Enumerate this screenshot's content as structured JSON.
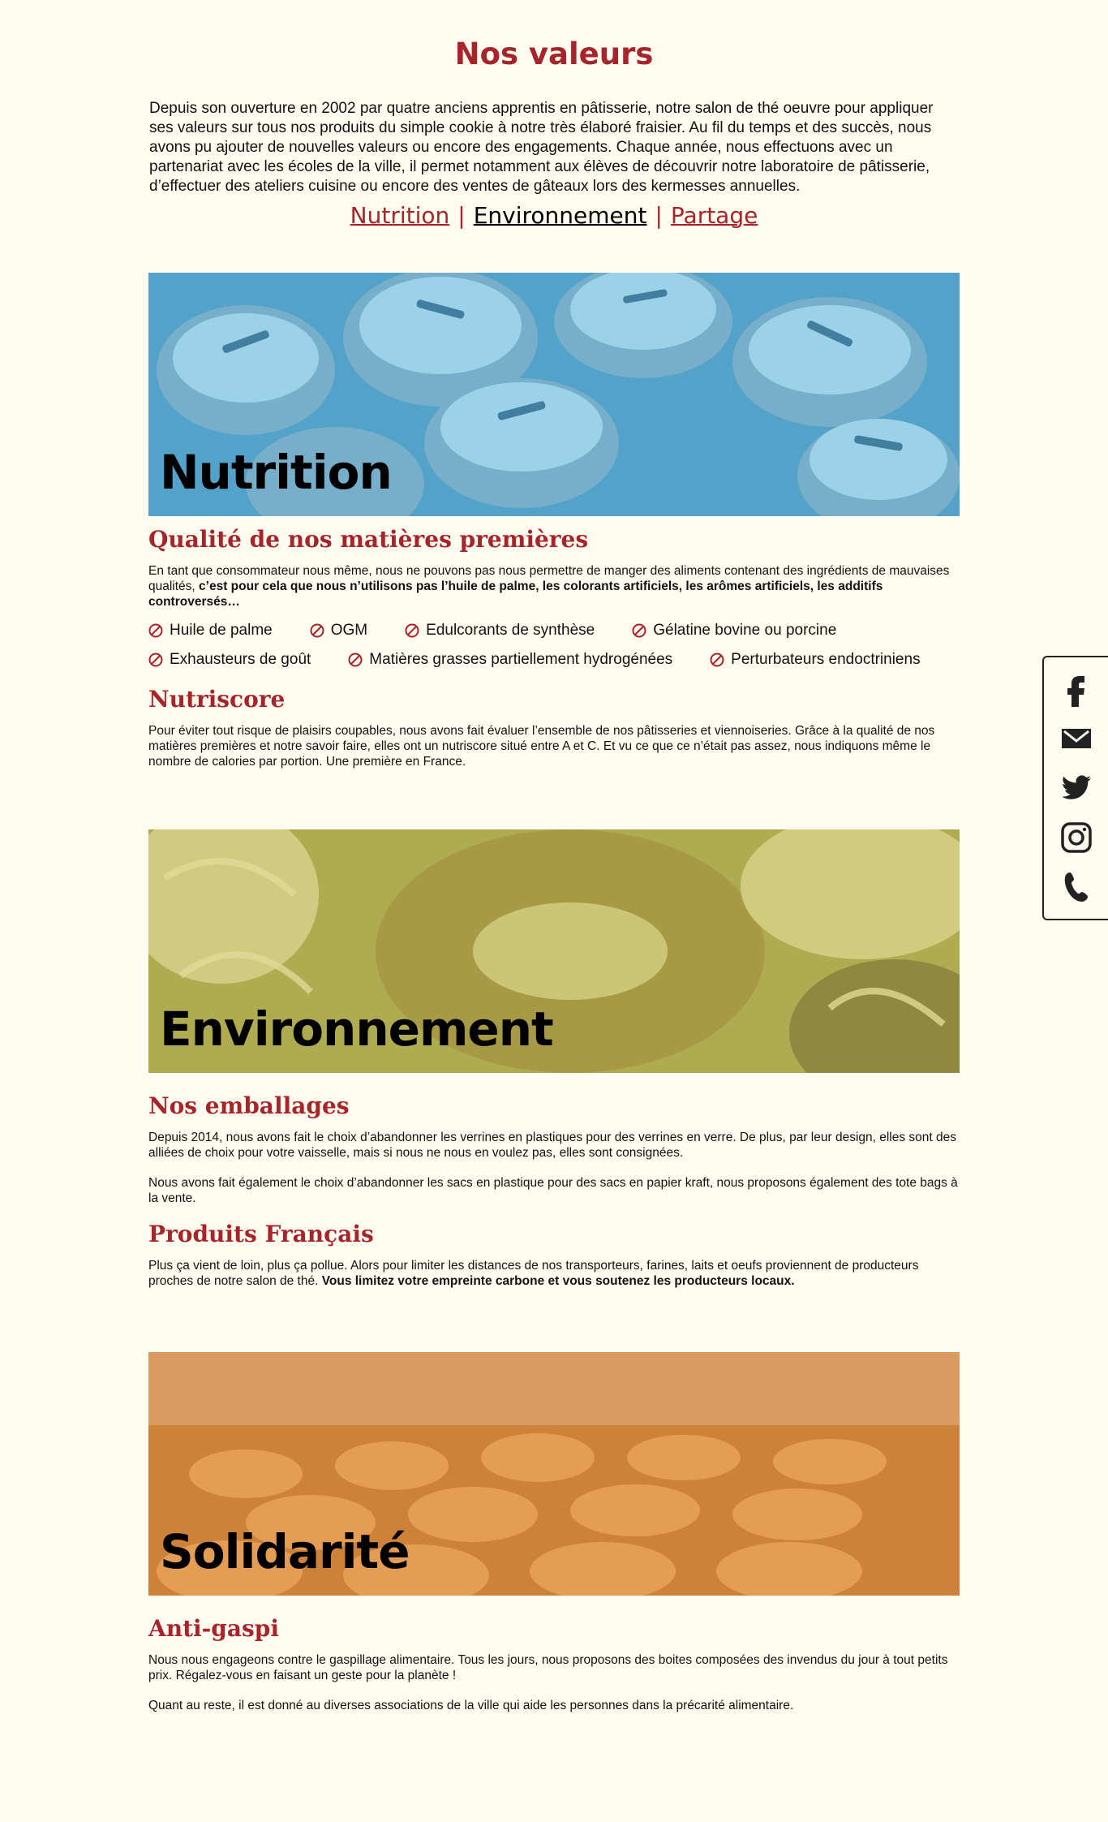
{
  "page": {
    "title": "Nos valeurs",
    "intro": "Depuis son ouverture en 2002 par quatre anciens apprentis en pâtisserie, notre salon de thé oeuvre pour appliquer ses valeurs sur tous nos produits du simple cookie à notre très élaboré fraisier. Au fil du temps et des succès, nous avons pu ajouter de nouvelles valeurs ou encore des engagements. Chaque année, nous effectuons avec un partenariat avec les écoles de la ville, il permet notamment aux élèves de découvrir notre laboratoire de pâtisserie, d’effectuer des ateliers cuisine ou encore des ventes de gâteaux lors des kermesses annuelles."
  },
  "nav": {
    "items": [
      "Nutrition",
      "Environnement",
      "Partage"
    ],
    "separator": "|"
  },
  "nutrition": {
    "banner_title": "Nutrition",
    "quality_title": "Qualité de nos matières premières",
    "quality_text": "En tant que consommateur nous même, nous ne pouvons pas nous permettre de manger des aliments contenant des ingrédients de mauvaises qualités, ",
    "quality_bold": "c’est pour cela que nous n’utilisons pas l’huile de palme, les colorants artificiels, les arômes artificiels, les additifs controversés…",
    "banned": [
      "Huile de palme",
      "OGM",
      "Edulcorants de synthèse",
      "Gélatine bovine ou porcine",
      "Exhausteurs de goût",
      "Matières grasses partiellement hydrogénées",
      "Perturbateurs endoctriniens"
    ],
    "nutriscore_title": "Nutriscore",
    "nutriscore_text": "Pour éviter tout risque de plaisirs coupables, nous avons fait évaluer l’ensemble de nos pâtisseries et viennoiseries. Grâce à la qualité de nos matières premières et notre savoir faire, elles ont un nutriscore situé entre A et C. Et vu ce que ce n’était pas assez, nous indiquons même le nombre de calories par portion. Une première en France."
  },
  "environnement": {
    "banner_title": "Environnement",
    "emballages_title": "Nos emballages",
    "emballages_p1": "Depuis 2014, nous avons fait le choix d’abandonner les verrines en plastiques pour des verrines en verre. De plus, par leur design, elles sont des alliées de choix pour votre vaisselle, mais si nous ne nous en voulez pas, elles sont consignées.",
    "emballages_p2": "Nous avons fait également le choix d’abandonner les sacs en plastique pour des sacs en papier kraft, nous proposons également des tote bags à la vente.",
    "produits_title": "Produits Français",
    "produits_text": "Plus ça vient de loin, plus ça pollue. Alors pour limiter les distances de nos transporteurs, farines, laits et oeufs proviennent de producteurs proches de notre salon de thé. ",
    "produits_bold": "Vous limitez votre empreinte carbone et vous soutenez les producteurs locaux."
  },
  "solidarite": {
    "banner_title": "Solidarité",
    "gaspi_title": "Anti-gaspi",
    "gaspi_p1": "Nous nous engageons contre le gaspillage alimentaire. Tous les jours, nous proposons des boites composées des invendus du jour à tout petits prix. Régalez-vous en faisant un geste pour la planète !",
    "gaspi_p2": "Quant au reste, il est donné au diverses associations de la ville qui aide les personnes dans la précarité alimentaire."
  },
  "social": {
    "icons": [
      "facebook-icon",
      "mail-icon",
      "twitter-icon",
      "instagram-icon",
      "phone-icon"
    ]
  },
  "colors": {
    "accent": "#a8242b",
    "background": "#fffdf0",
    "nutrition_overlay": "#5cb8df",
    "environnement_overlay": "#c9c25a",
    "solidarite_overlay": "#e0934a"
  }
}
